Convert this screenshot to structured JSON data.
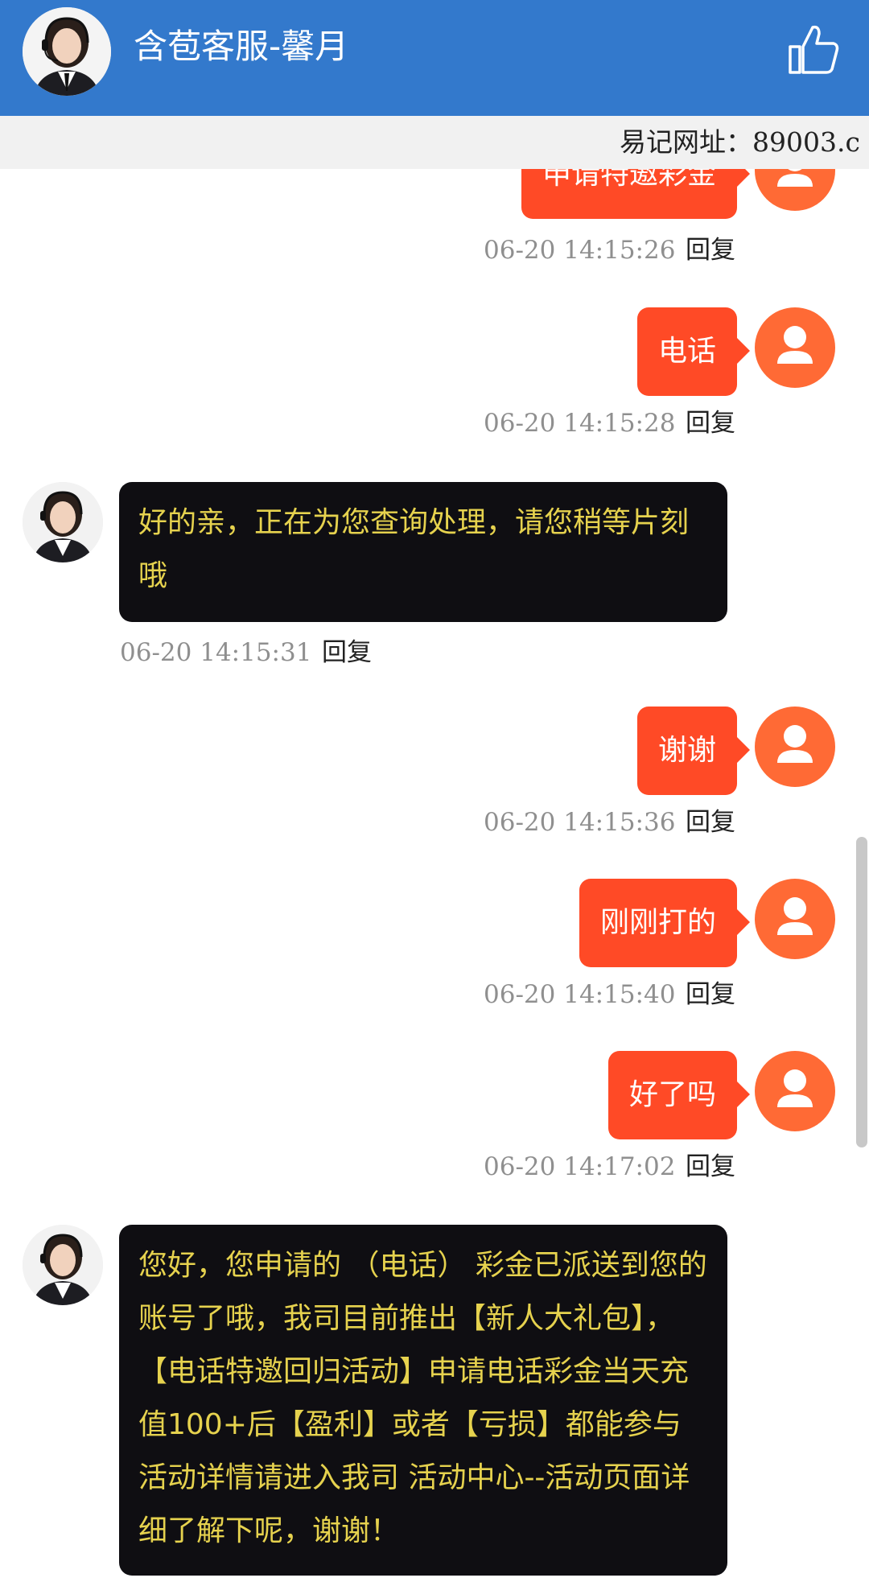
{
  "header": {
    "title": "含苞客服-馨月",
    "like_icon": "thumbs-up-icon",
    "avatar_icon": "agent-avatar-icon"
  },
  "marquee": {
    "text": "易记网址：89003.c"
  },
  "messages": [
    {
      "side": "user",
      "text": "申请特邀彩金",
      "time": "06-20 14:15:26",
      "reply": "回复"
    },
    {
      "side": "user",
      "text": "电话",
      "time": "06-20 14:15:28",
      "reply": "回复"
    },
    {
      "side": "agent",
      "text": "好的亲，正在为您查询处理，请您稍等片刻哦",
      "time": "06-20 14:15:31",
      "reply": "回复"
    },
    {
      "side": "user",
      "text": "谢谢",
      "time": "06-20 14:15:36",
      "reply": "回复"
    },
    {
      "side": "user",
      "text": "刚刚打的",
      "time": "06-20 14:15:40",
      "reply": "回复"
    },
    {
      "side": "user",
      "text": "好了吗",
      "time": "06-20 14:17:02",
      "reply": "回复"
    },
    {
      "side": "agent",
      "text": "您好，您申请的 （电话） 彩金已派送到您的账号了哦，我司目前推出【新人大礼包】，【电话特邀回归活动】申请电话彩金当天充值100+后【盈利】或者【亏损】都能参与 活动详情请进入我司 活动中心--活动页面详细了解下呢，谢谢！",
      "time": "",
      "reply": ""
    }
  ],
  "colors": {
    "header_bg": "#3379cc",
    "user_bubble": "#ff4a26",
    "user_avatar": "#ff6a35",
    "agent_bubble": "#0f0e12",
    "agent_text": "#e6d24e"
  }
}
